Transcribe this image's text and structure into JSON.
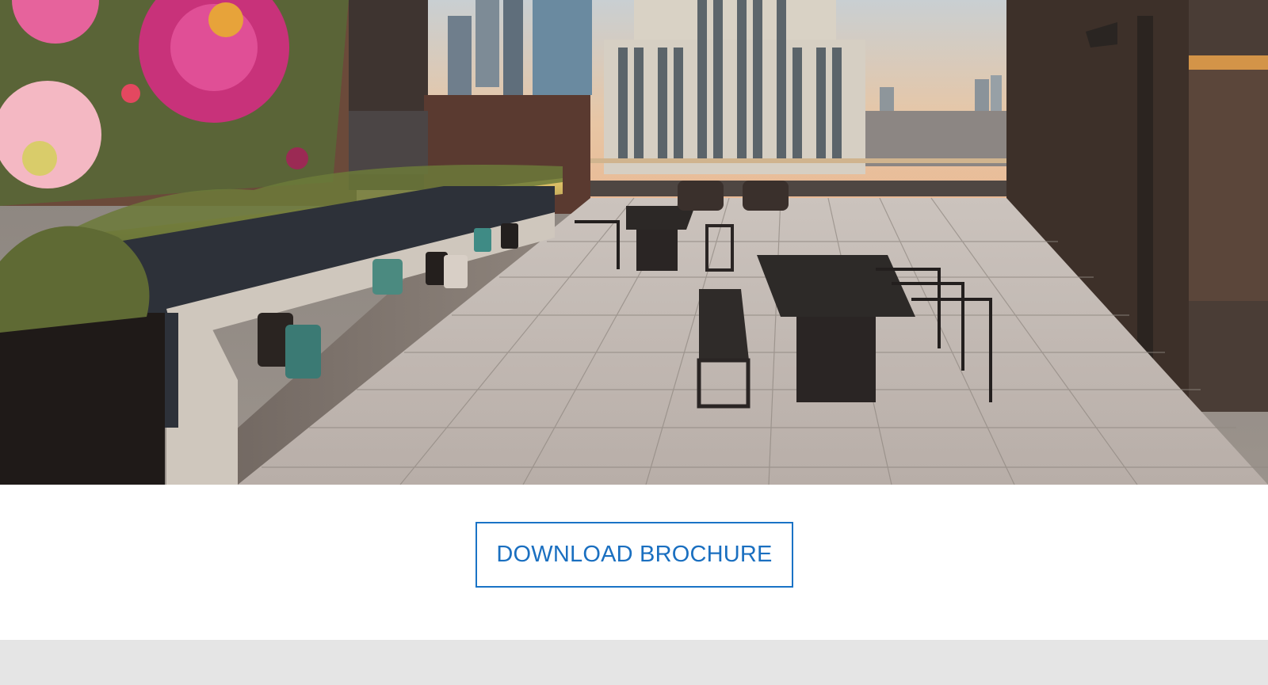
{
  "hero": {
    "image_description_icon": "rooftop-terrace-photo"
  },
  "cta": {
    "label": "DOWNLOAD BROCHURE"
  },
  "colors": {
    "accent": "#1a6fc0",
    "footer_band": "#e5e5e5"
  }
}
